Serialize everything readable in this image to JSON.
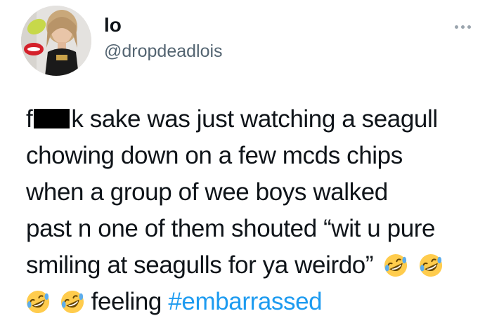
{
  "user": {
    "display_name": "lo",
    "handle": "@dropdeadlois"
  },
  "icons": {
    "more": "more-horizontal-icon",
    "emoji": "rolling-on-the-floor-laughing-emoji"
  },
  "tweet": {
    "censored_word": "f**k",
    "line1_start": "f",
    "line1_end": "k sake was just watching a seagull",
    "line2": "chowing down on a few mcds chips",
    "line3": "when a group of wee boys walked",
    "line4": "past n one of them shouted “wit u pure",
    "line5": "smiling at seagulls for ya weirdo”",
    "line6_text": "feeling ",
    "hashtag": "#embarrassed"
  },
  "colors": {
    "link": "#1d9bf0",
    "handle": "#536471",
    "text": "#0f1419"
  }
}
